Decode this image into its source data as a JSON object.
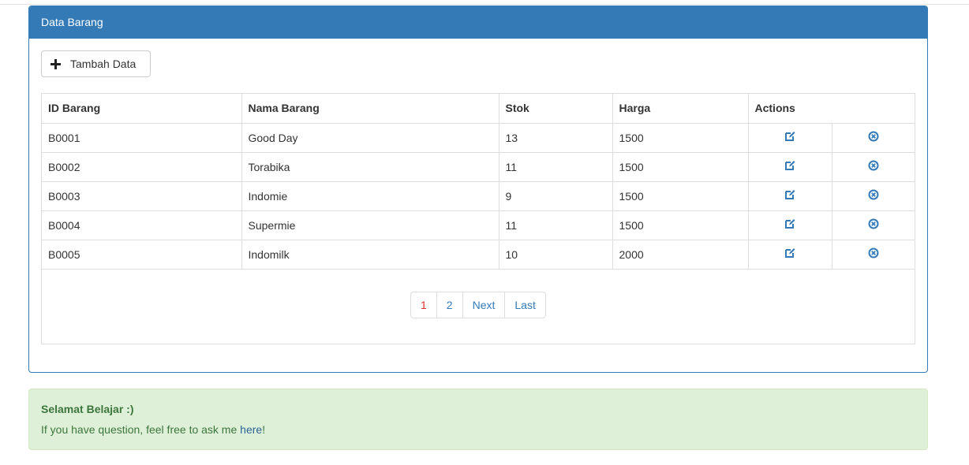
{
  "panel": {
    "title": "Data Barang",
    "add_button_label": "Tambah Data"
  },
  "table": {
    "headers": [
      "ID Barang",
      "Nama Barang",
      "Stok",
      "Harga",
      "Actions"
    ],
    "rows": [
      {
        "id": "B0001",
        "nama": "Good Day",
        "stok": "13",
        "harga": "1500"
      },
      {
        "id": "B0002",
        "nama": "Torabika",
        "stok": "11",
        "harga": "1500"
      },
      {
        "id": "B0003",
        "nama": "Indomie",
        "stok": "9",
        "harga": "1500"
      },
      {
        "id": "B0004",
        "nama": "Supermie",
        "stok": "11",
        "harga": "1500"
      },
      {
        "id": "B0005",
        "nama": "Indomilk",
        "stok": "10",
        "harga": "2000"
      }
    ],
    "row_icons": {
      "edit": "edit-icon",
      "delete": "delete-circle-icon"
    }
  },
  "pagination": {
    "pages": [
      "1",
      "2"
    ],
    "current": "1",
    "next_label": "Next",
    "last_label": "Last"
  },
  "alert": {
    "title": "Selamat Belajar :)",
    "message_prefix": "If you have question, feel free to ask me ",
    "link_text": "here",
    "message_suffix": "!"
  },
  "colors": {
    "primary": "#337ab7",
    "success_bg": "#dff0d8",
    "success_text": "#3c763d",
    "active_page": "#e0302a"
  }
}
